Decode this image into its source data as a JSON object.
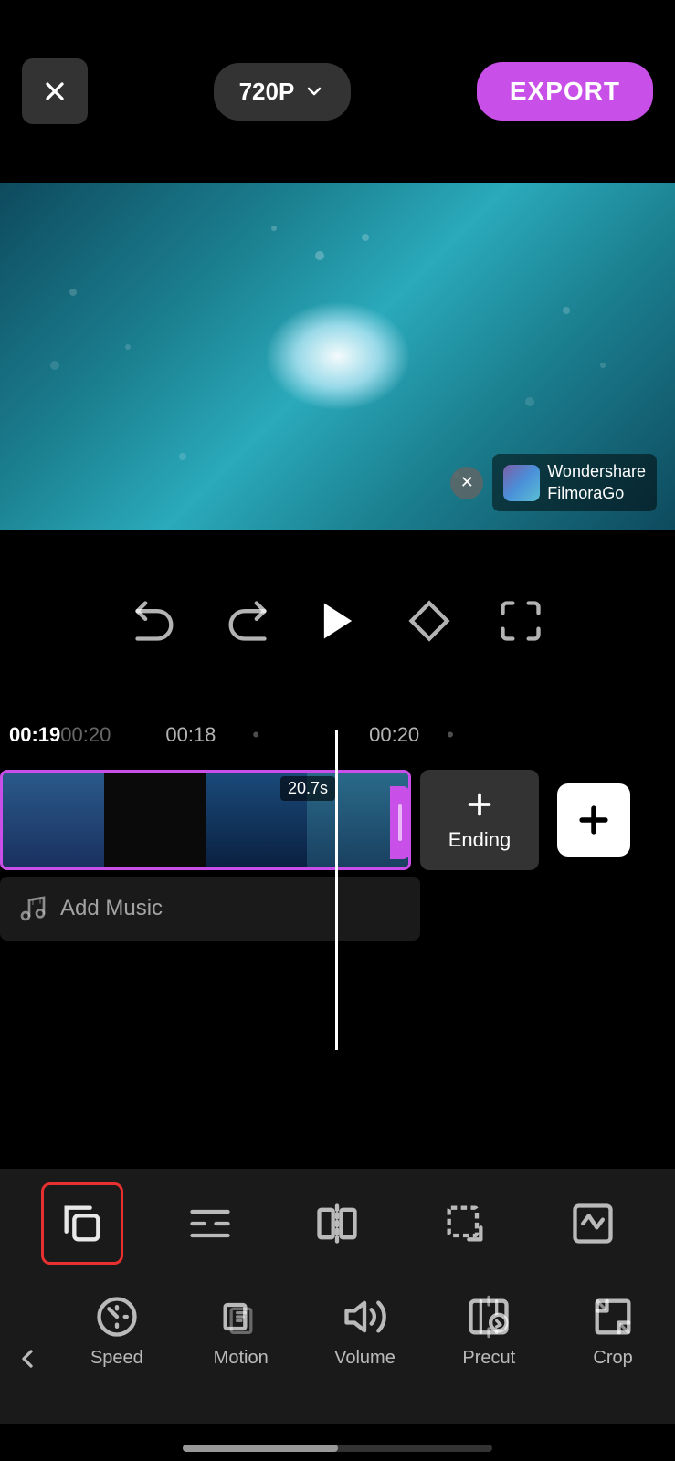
{
  "header": {
    "quality_label": "720P",
    "export_label": "EXPORT"
  },
  "watermark": {
    "brand": "Wondershare\nFilmoraGo"
  },
  "controls": {
    "undo_title": "Undo",
    "redo_title": "Redo",
    "play_title": "Play",
    "keyframe_title": "Keyframe",
    "fullscreen_title": "Fullscreen"
  },
  "timestamps": {
    "current": "00:19",
    "total": "00:20",
    "t1": "00:18",
    "t2": "00:20"
  },
  "clip": {
    "duration": "20.7s",
    "ending_label": "Ending"
  },
  "add_music_label": "Add Music",
  "toolbar": {
    "icons": [
      {
        "name": "copy",
        "active": true
      },
      {
        "name": "trim"
      },
      {
        "name": "split"
      },
      {
        "name": "crop-corner"
      },
      {
        "name": "keyframe-graph"
      }
    ]
  },
  "bottom_nav": {
    "back_label": "<",
    "items": [
      {
        "id": "speed",
        "label": "Speed"
      },
      {
        "id": "motion",
        "label": "Motion"
      },
      {
        "id": "volume",
        "label": "Volume"
      },
      {
        "id": "precut",
        "label": "Precut"
      },
      {
        "id": "crop",
        "label": "Crop"
      }
    ]
  }
}
